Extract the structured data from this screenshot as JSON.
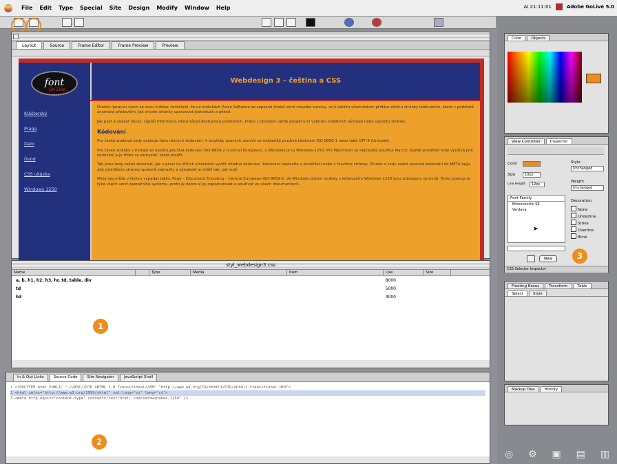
{
  "menubar": {
    "items": [
      "File",
      "Edit",
      "Type",
      "Special",
      "Site",
      "Design",
      "Modify",
      "Window",
      "Help"
    ],
    "clock": "AI 21:11:01",
    "app_label": "Adobe GoLive 5.0"
  },
  "doc_window": {
    "tabs": [
      "Layout",
      "Source",
      "Frame Editor",
      "Frame Preview",
      "Preview"
    ],
    "page": {
      "logo": "font",
      "logo_sub": "On Line",
      "header": "Webdesign 3 – čeština a CSS",
      "nav": [
        "Klášterský",
        "Praga",
        "Dalo",
        "Úvod",
        "CSS ukázka",
        "Windows 1250"
      ],
      "p1": "Dnešní úpravou navíc se svou krátkou tentokrát, že na stránkách Avizo Software se zapsané široká verzí stavebe kurzivy, se k dalším vlastnostem přidáte zálohu stránky kódováním, které v podstatě znamená především, jak chcete stránky upravovat jednoduše a pěkně.",
      "p2": "Jak psát a ukázat obraz, zápisů informace, které týkají dostupnou posledních. Práce s obrazem vedle pozadí určí výbírání zvláštních výstupů nebo výpočtu stránky.",
      "h3": "Kódování",
      "p3": "Pro české znakové sady existuje řada různých kódování. V anglicky psaných zemích se nejčastěji používá kódování ISO 8859-1 nebo také UTF-8 (Unicode).",
      "p4": "Pro české stránky v Evropě se nejvíce používá kódování ISO-8859-2 (Central European), u Windows je to Windows-1250. Pro Macintosh se nejčastěji používá MacCE. Každé prostředí tedy využívá jiné kódování a je třeba se zamyslet, které použít.",
      "p5": "Tak jsme tedy začali zkoumat, jak v praxi na dílčích stránkách využít vhodné kódování. Kódování nastavíte v prohlížeči nebo v hlavičce stránky. Zkuste si tedy zadat správné kódování do META tagu, aby prohlížeče stránky správně zobrazily a uživatelé je viděli tak, jak mají.",
      "p6": "Meta tag může v Golivu vypadat takto: Page – Document Encoding – Central European ISO-8859-2. Ve Windows potom stránky s kódováním Windows-1250 jsou zobrazeny správně. Tento postup se týká všech verzí operačního systému, proto je dobré si jej zapamatovat a používat ve všech dokumentech."
    }
  },
  "css_window": {
    "title": "styl_webdesign3.css",
    "columns": [
      "Name",
      "",
      "Type",
      "Media",
      "Item",
      "Use",
      "Size"
    ],
    "rows": [
      {
        "name": "a, b, h1, h2, h3, hr, td, table, div",
        "value": "8000"
      },
      {
        "name": "td",
        "value": "5000"
      },
      {
        "name": "h3",
        "value": "4000"
      }
    ],
    "badge": "1"
  },
  "code_window": {
    "tabs": [
      "In & Out Links",
      "Source Code",
      "Site Navigator",
      "JavaScript Shell"
    ],
    "lines": [
      "1 <!DOCTYPE html PUBLIC \"-//W3C//DTD XHTML 1.0 Transitional//EN\" \"http://www.w3.org/TR/xhtml1/DTD/xhtml1-transitional.dtd\">",
      "2 <html xmlns=\"http://www.w3.org/1999/xhtml\" xml:lang=\"cs\" lang=\"cs\">",
      "3 <meta http-equiv=\"content-type\" content=\"text/html; charset=windows-1250\" />"
    ],
    "badge": "2"
  },
  "right_panels": {
    "color_tabs": [
      "Color",
      "Objects"
    ],
    "inspector_tabs": [
      "View Controller",
      "Inspector"
    ],
    "inspector_fields": {
      "color_label": "Color",
      "size_label": "Size",
      "size_value": "10px",
      "line_height_label": "Line Height",
      "line_height_value": "12px",
      "style_label": "Style",
      "style_value": "Unchanged",
      "weight_label": "Weight",
      "weight_value": "Unchanged",
      "font_family_label": "Font Family",
      "fonts": [
        "Ethnocentric SE",
        "Verdana"
      ],
      "decoration_label": "Decoration",
      "decorations": [
        "None",
        "Underline",
        "Strike",
        "Overline",
        "Blink"
      ],
      "new_button": "New"
    },
    "css_editor": "CSS Selector Inspector",
    "transform_tabs": [
      "Floating Boxes",
      "Transform",
      "Table"
    ],
    "transform_subtabs": [
      "Select",
      "Style"
    ],
    "history_tabs": [
      "Markup Tree",
      "History"
    ],
    "badge": "3"
  },
  "colors": {
    "page_red": "#c42b22",
    "nav_blue": "#23307e",
    "content_orange": "#eea12a",
    "badge_orange": "#ef8c1c"
  }
}
